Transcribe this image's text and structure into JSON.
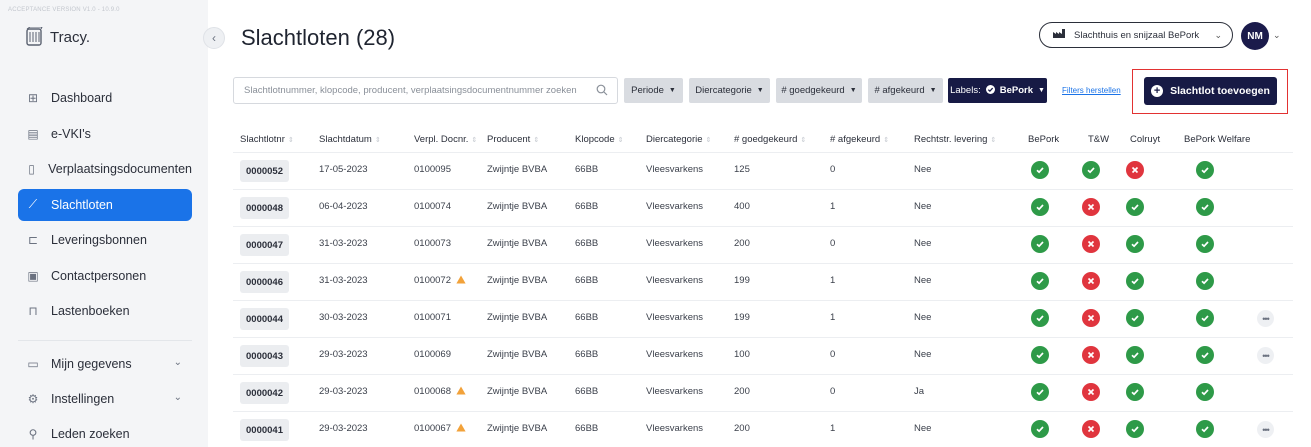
{
  "app": {
    "version": "ACCEPTANCE VERSION V1.0 - 10.9.0",
    "logo_text": "Tracy."
  },
  "sidebar": {
    "items": [
      {
        "label": "Dashboard",
        "icon": "dashboard-icon"
      },
      {
        "label": "e-VKI's",
        "icon": "document-stack-icon"
      },
      {
        "label": "Verplaatsingsdocumenten",
        "icon": "file-icon"
      },
      {
        "label": "Slachtloten",
        "icon": "knife-icon",
        "active": true
      },
      {
        "label": "Leveringsbonnen",
        "icon": "delivery-icon"
      },
      {
        "label": "Contactpersonen",
        "icon": "contact-icon"
      },
      {
        "label": "Lastenboeken",
        "icon": "book-icon"
      }
    ],
    "bottom_items": [
      {
        "label": "Mijn gegevens",
        "icon": "id-card-icon",
        "expandable": true
      },
      {
        "label": "Instellingen",
        "icon": "gear-icon",
        "expandable": true
      },
      {
        "label": "Leden zoeken",
        "icon": "search-icon"
      }
    ]
  },
  "header": {
    "title": "Slachtloten (28)",
    "org_name": "Slachthuis en snijzaal BePork",
    "avatar_initials": "NM"
  },
  "toolbar": {
    "search_placeholder": "Slachtlotnummer, klopcode, producent, verplaatsingsdocumentnummer zoeken",
    "filters": [
      "Periode",
      "Diercategorie",
      "# goedgekeurd",
      "# afgekeurd"
    ],
    "labels_filter_prefix": "Labels:",
    "labels_filter_value": "BePork",
    "reset_filters": "Filters herstellen",
    "add_button": "Slachtlot toevoegen"
  },
  "table": {
    "columns": [
      "Slachtlotnr",
      "Slachtdatum",
      "Verpl. Docnr.",
      "Producent",
      "Klopcode",
      "Diercategorie",
      "# goedgekeurd",
      "# afgekeurd",
      "Rechtstr. levering",
      "BePork",
      "T&W",
      "Colruyt",
      "BePork Welfare"
    ],
    "rows": [
      {
        "nr": "0000052",
        "datum": "17-05-2023",
        "docnr": "0100095",
        "warn": false,
        "producent": "Zwijntje BVBA",
        "klopcode": "66BB",
        "categorie": "Vleesvarkens",
        "goed": "125",
        "afgekeurd": "0",
        "levering": "Nee",
        "bepork": true,
        "tw": true,
        "colruyt": false,
        "welfare": true,
        "more": false
      },
      {
        "nr": "0000048",
        "datum": "06-04-2023",
        "docnr": "0100074",
        "warn": false,
        "producent": "Zwijntje BVBA",
        "klopcode": "66BB",
        "categorie": "Vleesvarkens",
        "goed": "400",
        "afgekeurd": "1",
        "levering": "Nee",
        "bepork": true,
        "tw": false,
        "colruyt": true,
        "welfare": true,
        "more": false
      },
      {
        "nr": "0000047",
        "datum": "31-03-2023",
        "docnr": "0100073",
        "warn": false,
        "producent": "Zwijntje BVBA",
        "klopcode": "66BB",
        "categorie": "Vleesvarkens",
        "goed": "200",
        "afgekeurd": "0",
        "levering": "Nee",
        "bepork": true,
        "tw": false,
        "colruyt": true,
        "welfare": true,
        "more": false
      },
      {
        "nr": "0000046",
        "datum": "31-03-2023",
        "docnr": "0100072",
        "warn": true,
        "producent": "Zwijntje BVBA",
        "klopcode": "66BB",
        "categorie": "Vleesvarkens",
        "goed": "199",
        "afgekeurd": "1",
        "levering": "Nee",
        "bepork": true,
        "tw": false,
        "colruyt": true,
        "welfare": true,
        "more": false
      },
      {
        "nr": "0000044",
        "datum": "30-03-2023",
        "docnr": "0100071",
        "warn": false,
        "producent": "Zwijntje BVBA",
        "klopcode": "66BB",
        "categorie": "Vleesvarkens",
        "goed": "199",
        "afgekeurd": "1",
        "levering": "Nee",
        "bepork": true,
        "tw": false,
        "colruyt": true,
        "welfare": true,
        "more": true
      },
      {
        "nr": "0000043",
        "datum": "29-03-2023",
        "docnr": "0100069",
        "warn": false,
        "producent": "Zwijntje BVBA",
        "klopcode": "66BB",
        "categorie": "Vleesvarkens",
        "goed": "100",
        "afgekeurd": "0",
        "levering": "Nee",
        "bepork": true,
        "tw": false,
        "colruyt": true,
        "welfare": true,
        "more": true
      },
      {
        "nr": "0000042",
        "datum": "29-03-2023",
        "docnr": "0100068",
        "warn": true,
        "producent": "Zwijntje BVBA",
        "klopcode": "66BB",
        "categorie": "Vleesvarkens",
        "goed": "200",
        "afgekeurd": "0",
        "levering": "Ja",
        "bepork": true,
        "tw": false,
        "colruyt": true,
        "welfare": true,
        "more": false
      },
      {
        "nr": "0000041",
        "datum": "29-03-2023",
        "docnr": "0100067",
        "warn": true,
        "producent": "Zwijntje BVBA",
        "klopcode": "66BB",
        "categorie": "Vleesvarkens",
        "goed": "200",
        "afgekeurd": "1",
        "levering": "Nee",
        "bepork": true,
        "tw": false,
        "colruyt": true,
        "welfare": true,
        "more": true
      }
    ]
  },
  "colors": {
    "accent": "#1a73e8",
    "primary_dark": "#171a45",
    "status_ok": "#2e9a48",
    "status_fail": "#e0353e",
    "warning": "#f2a23a",
    "highlight_box": "#e23232"
  }
}
